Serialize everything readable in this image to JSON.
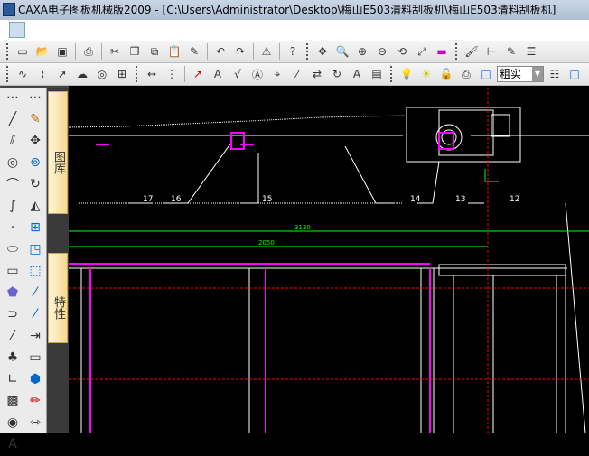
{
  "window": {
    "title": "CAXA电子图板机械版2009 - [C:\\Users\\Administrator\\Desktop\\梅山E503清料刮板机\\梅山E503清料刮板机]"
  },
  "toolbar2": {
    "linetype_value": "粗实"
  },
  "side_tabs": [
    {
      "label": "图库"
    },
    {
      "label": "特性"
    }
  ],
  "drawing": {
    "balloons": [
      "17",
      "16",
      "15",
      "14",
      "13",
      "12"
    ],
    "dimensions": [
      "3130",
      "2050"
    ],
    "colors": {
      "background": "#000000",
      "outline": "#ffffff",
      "parts": "#ff00ff",
      "dimension": "#00ff00",
      "centerline": "#ff0000"
    }
  }
}
